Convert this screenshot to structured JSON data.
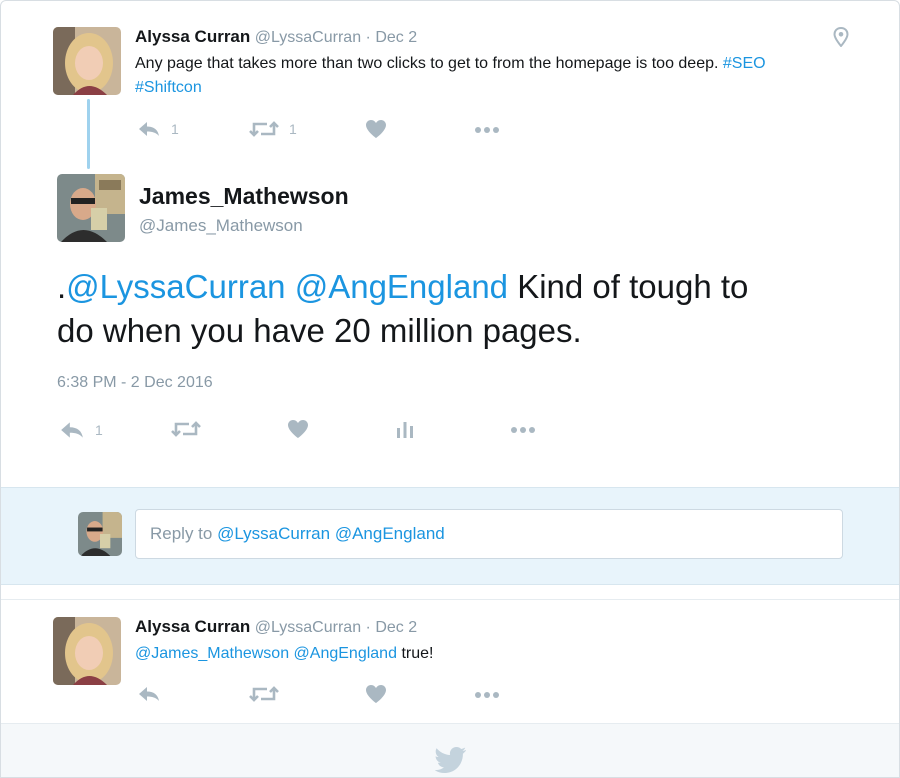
{
  "tweet1": {
    "name": "Alyssa Curran",
    "handle": "@LyssaCurran",
    "date": "· Dec 2",
    "text_plain": "Any page that takes more than two clicks to get to from the homepage is too deep.",
    "hashtags": [
      "#SEO",
      "#Shiftcon"
    ],
    "reply_count": "1",
    "retweet_count": "1"
  },
  "main_tweet": {
    "name": "James_Mathewson",
    "handle": "@James_Mathewson",
    "mention_prefix": ".",
    "mentions": [
      "@LyssaCurran",
      "@AngEngland"
    ],
    "text_rest_line1": "Kind of tough to",
    "text_line2": "do when you have 20 million pages.",
    "timestamp": "6:38 PM - 2 Dec 2016",
    "reply_count": "1"
  },
  "reply_composer": {
    "prefix": "Reply to ",
    "mentions": [
      "@LyssaCurran",
      "@AngEngland"
    ]
  },
  "tweet3": {
    "name": "Alyssa Curran",
    "handle": "@LyssaCurran",
    "date": "· Dec 2",
    "mentions": [
      "@James_Mathewson",
      "@AngEngland"
    ],
    "text_rest": "true!"
  },
  "icons": {
    "location": "location-pin-icon",
    "reply": "reply-icon",
    "retweet": "retweet-icon",
    "like": "heart-icon",
    "analytics": "analytics-icon",
    "more": "more-icon",
    "footer": "twitter-bird-icon"
  },
  "colors": {
    "link": "#1b95e0",
    "muted": "#8899a6",
    "icon": "#aab8c2",
    "thread_line": "#9fd2ee",
    "reply_band": "#e8f4fb"
  }
}
